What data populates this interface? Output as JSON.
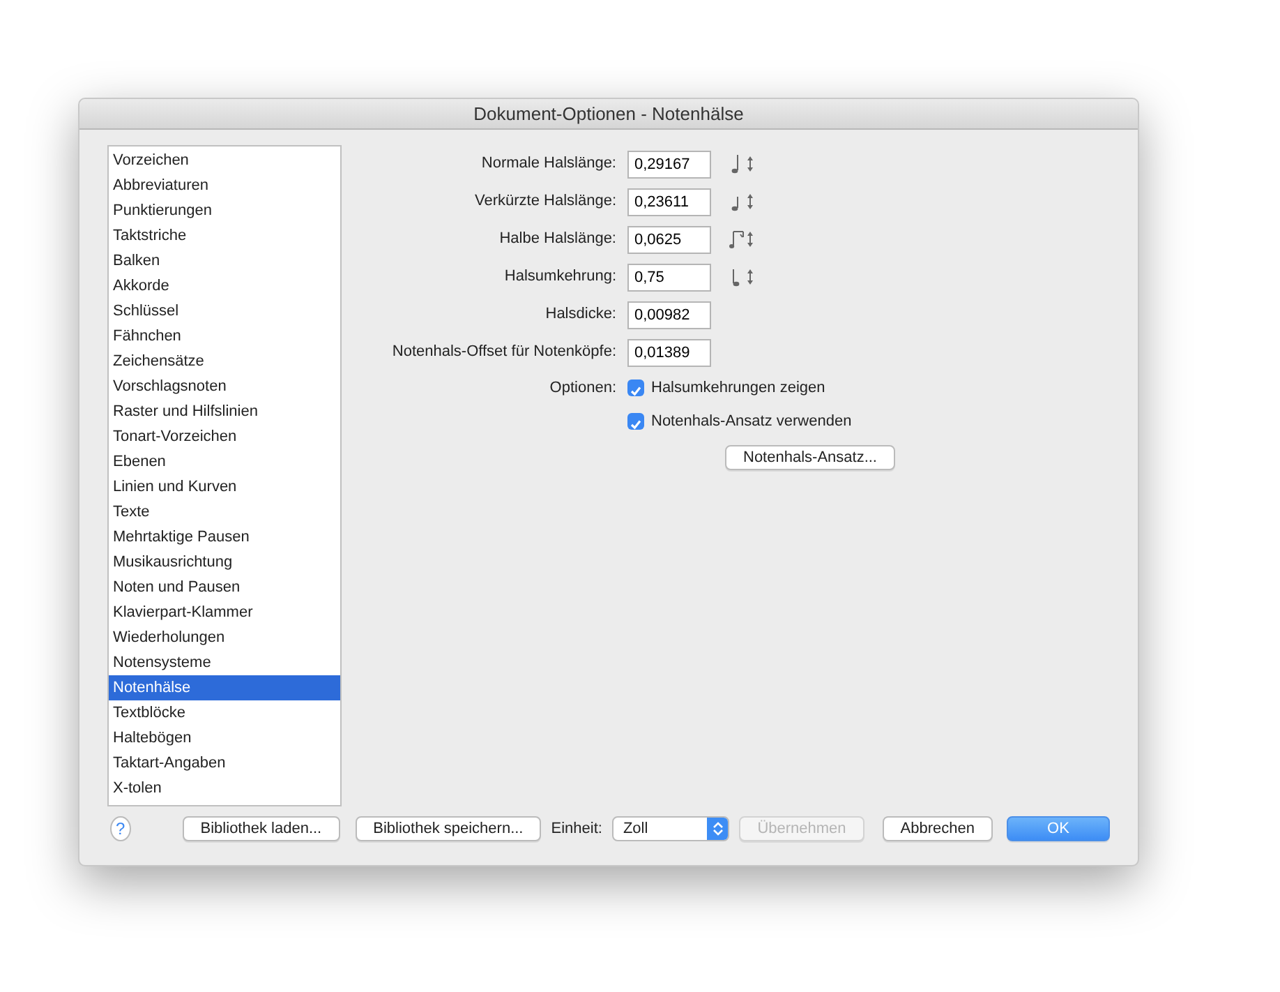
{
  "window": {
    "title": "Dokument-Optionen - Notenhälse"
  },
  "sidebar": {
    "items": [
      {
        "label": "Vorzeichen",
        "selected": false
      },
      {
        "label": "Abbreviaturen",
        "selected": false
      },
      {
        "label": "Punktierungen",
        "selected": false
      },
      {
        "label": "Taktstriche",
        "selected": false
      },
      {
        "label": "Balken",
        "selected": false
      },
      {
        "label": "Akkorde",
        "selected": false
      },
      {
        "label": "Schlüssel",
        "selected": false
      },
      {
        "label": "Fähnchen",
        "selected": false
      },
      {
        "label": "Zeichensätze",
        "selected": false
      },
      {
        "label": "Vorschlagsnoten",
        "selected": false
      },
      {
        "label": "Raster und Hilfslinien",
        "selected": false
      },
      {
        "label": "Tonart-Vorzeichen",
        "selected": false
      },
      {
        "label": "Ebenen",
        "selected": false
      },
      {
        "label": "Linien und Kurven",
        "selected": false
      },
      {
        "label": "Texte",
        "selected": false
      },
      {
        "label": "Mehrtaktige Pausen",
        "selected": false
      },
      {
        "label": "Musikausrichtung",
        "selected": false
      },
      {
        "label": "Noten und Pausen",
        "selected": false
      },
      {
        "label": "Klavierpart-Klammer",
        "selected": false
      },
      {
        "label": "Wiederholungen",
        "selected": false
      },
      {
        "label": "Notensysteme",
        "selected": false
      },
      {
        "label": "Notenhälse",
        "selected": true
      },
      {
        "label": "Textblöcke",
        "selected": false
      },
      {
        "label": "Haltebögen",
        "selected": false
      },
      {
        "label": "Taktart-Angaben",
        "selected": false
      },
      {
        "label": "X-tolen",
        "selected": false
      }
    ]
  },
  "fields": [
    {
      "label": "Normale Halslänge:",
      "value": "0,29167",
      "kind": "stem-long"
    },
    {
      "label": "Verkürzte Halslänge:",
      "value": "0,23611",
      "kind": "stem-short"
    },
    {
      "label": "Halbe Halslänge:",
      "value": "0,0625",
      "kind": "stem-beamed"
    },
    {
      "label": "Halsumkehrung:",
      "value": "0,75",
      "kind": "stem-down"
    },
    {
      "label": "Halsdicke:",
      "value": "0,00982",
      "kind": "plain"
    },
    {
      "label": "Notenhals-Offset für Notenköpfe:",
      "value": "0,01389",
      "kind": "plain"
    }
  ],
  "options": {
    "label": "Optionen:",
    "checkboxes": [
      {
        "label": "Halsumkehrungen zeigen",
        "checked": true
      },
      {
        "label": "Notenhals-Ansatz verwenden",
        "checked": true
      }
    ],
    "button": "Notenhals-Ansatz..."
  },
  "footer": {
    "help": "?",
    "buttons_left": [
      "Bibliothek laden...",
      "Bibliothek speichern..."
    ],
    "unit_label": "Einheit:",
    "unit_value": "Zoll",
    "buttons_right": [
      {
        "label": "Übernehmen",
        "disabled": true,
        "default": false
      },
      {
        "label": "Abbrechen",
        "disabled": false,
        "default": false
      },
      {
        "label": "OK",
        "disabled": false,
        "default": true
      }
    ]
  }
}
